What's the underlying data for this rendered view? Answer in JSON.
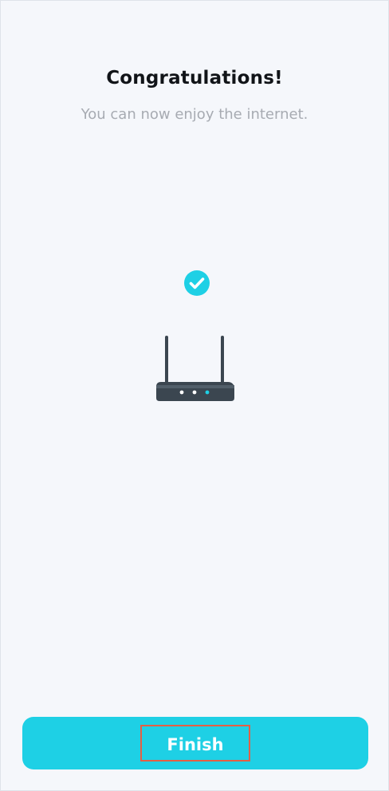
{
  "header": {
    "title": "Congratulations!",
    "subtitle": "You can now enjoy the internet."
  },
  "illustration": {
    "status_icon": "check-circle-icon",
    "device_icon": "router-icon",
    "accent_color": "#1ed0e5",
    "device_color": "#3b4650"
  },
  "actions": {
    "finish_label": "Finish",
    "finish_color": "#1ed0e5"
  }
}
